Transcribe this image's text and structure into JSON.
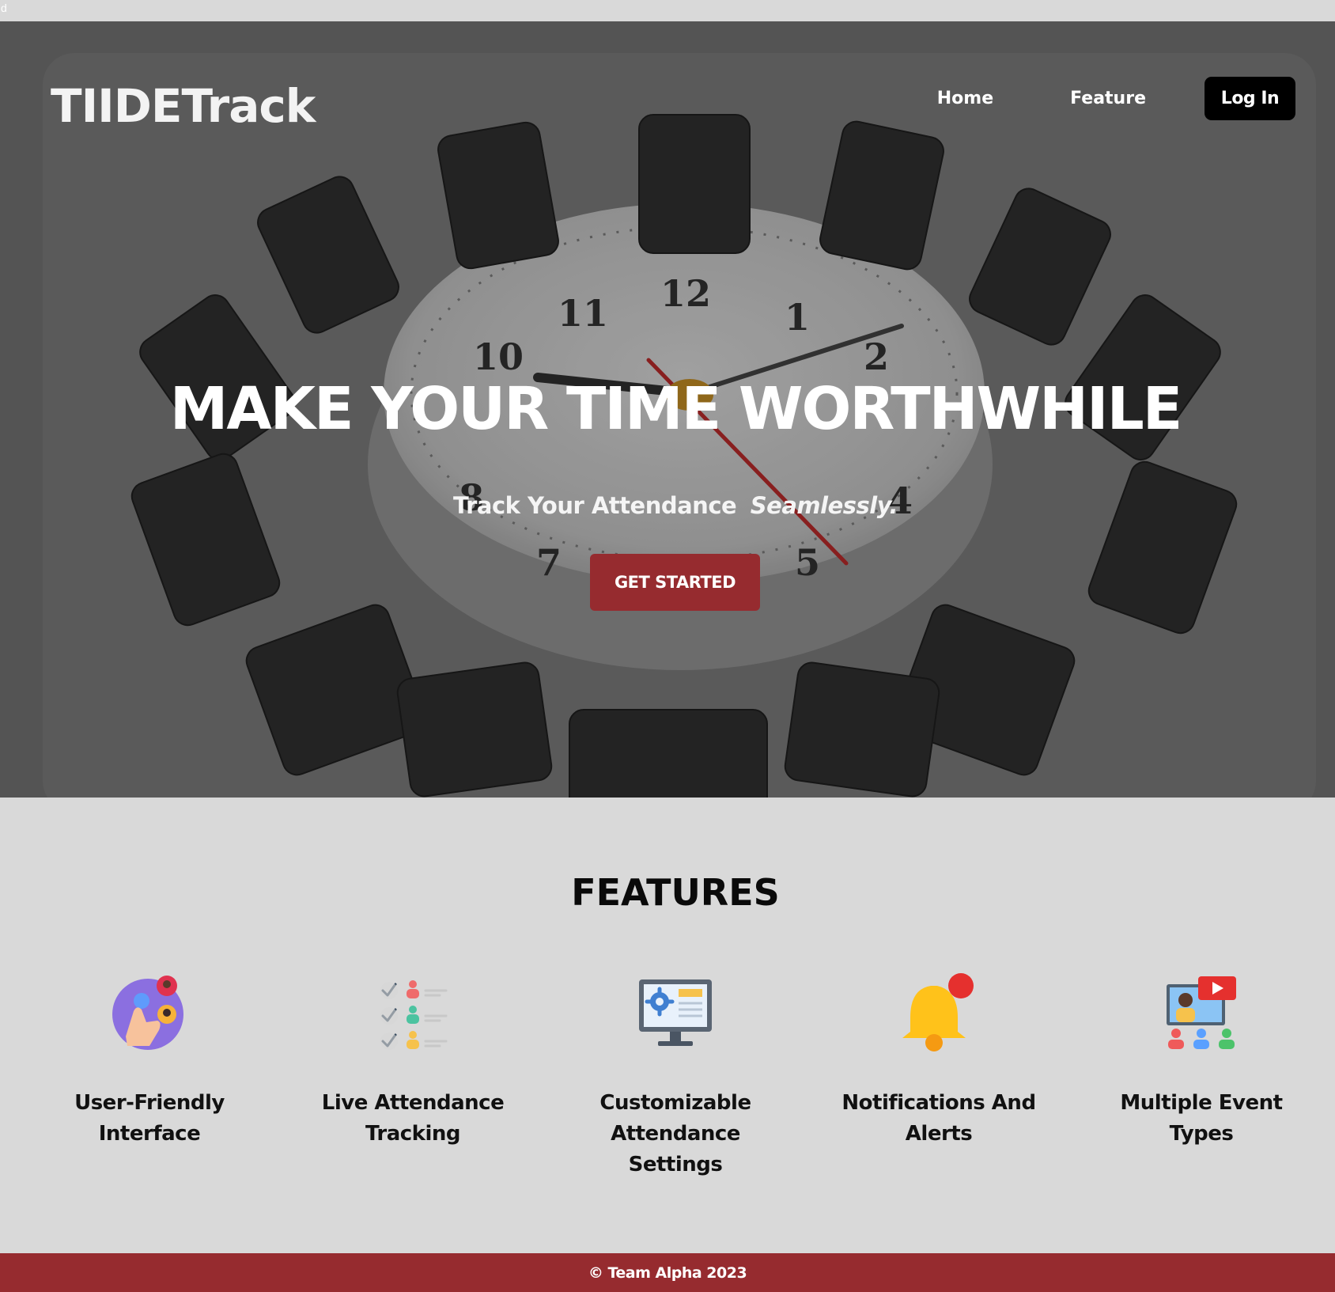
{
  "stray_text": "d",
  "brand": {
    "logo": "TIIDETrack"
  },
  "nav": {
    "home": "Home",
    "feature": "Feature",
    "login": "Log In"
  },
  "hero": {
    "headline": "MAKE YOUR TIME WORTHWHILE",
    "subline": "Track Your Attendance",
    "subline_emphasis": "Seamlessly.",
    "cta": "GET STARTED",
    "clock_numbers": [
      "12",
      "1",
      "2",
      "4",
      "5",
      "7",
      "8",
      "10",
      "11"
    ]
  },
  "features": {
    "title": "FEATURES",
    "items": [
      {
        "label": "User-Friendly Interface",
        "icon": "user-friendly-icon"
      },
      {
        "label": "Live Attendance Tracking",
        "icon": "checklist-icon"
      },
      {
        "label": "Customizable Attendance Settings",
        "icon": "monitor-settings-icon"
      },
      {
        "label": "Notifications And Alerts",
        "icon": "bell-icon"
      },
      {
        "label": "Multiple Event Types",
        "icon": "video-event-icon"
      }
    ]
  },
  "footer": {
    "text": "© Team Alpha 2023"
  },
  "colors": {
    "accent": "#962b2f",
    "page_bg": "#d9d9d9",
    "hero_bg": "#636363",
    "login_bg": "#000000"
  }
}
